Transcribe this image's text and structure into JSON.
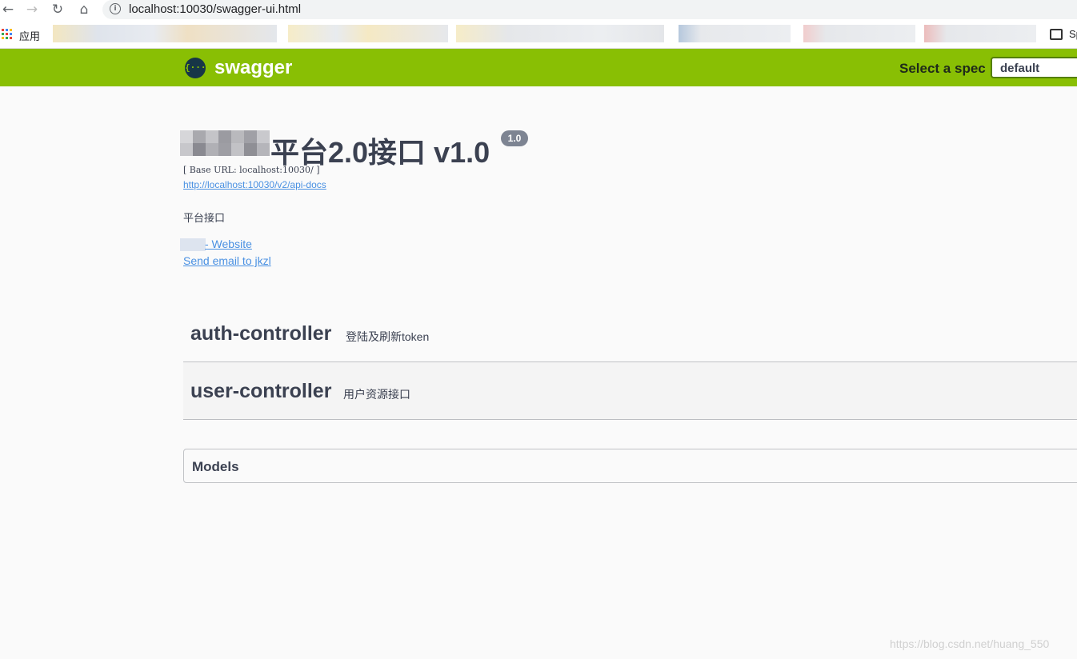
{
  "browser": {
    "url": "localhost:10030/swagger-ui.html",
    "apps_label": "应用",
    "bookmark_right_label": "Sp",
    "nav_icons": [
      "back-icon",
      "forward-icon",
      "reload-icon",
      "home-icon"
    ]
  },
  "topbar": {
    "logo_text": "swagger",
    "logo_glyph": "{···}",
    "spec_label": "Select a spec",
    "spec_selected": "default",
    "color": "#89bf04"
  },
  "info": {
    "title": "平台2.0接口 v1.0",
    "version": "1.0",
    "base_url": "[ Base URL: localhost:10030/ ]",
    "api_docs_link": "http://localhost:10030/v2/api-docs",
    "description": "平台接口",
    "website_link": "- Website",
    "email_link": "Send email to jkzl"
  },
  "tags": [
    {
      "name": "auth-controller",
      "description": "登陆及刷新token"
    },
    {
      "name": "user-controller",
      "description": "用户资源接口"
    }
  ],
  "models": {
    "title": "Models"
  },
  "watermark": "https://blog.csdn.net/huang_550"
}
